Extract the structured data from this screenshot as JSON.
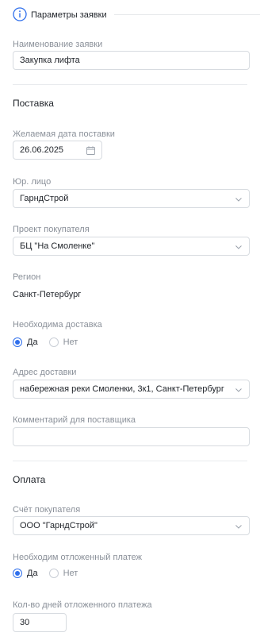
{
  "header": {
    "title": "Параметры заявки",
    "icon": "info-icon"
  },
  "request_name": {
    "label": "Наименование заявки",
    "value": "Закупка лифта"
  },
  "delivery": {
    "section_title": "Поставка",
    "date": {
      "label": "Желаемая дата поставки",
      "value": "26.06.2025"
    },
    "legal_entity": {
      "label": "Юр. лицо",
      "value": "ГарндСтрой"
    },
    "project": {
      "label": "Проект покупателя",
      "value": "БЦ \"На Смоленке\""
    },
    "region": {
      "label": "Регион",
      "value": "Санкт-Петербург"
    },
    "delivery_needed": {
      "label": "Необходима доставка",
      "options": [
        "Да",
        "Нет"
      ],
      "selected": "Да"
    },
    "address": {
      "label": "Адрес доставки",
      "value": "набережная реки Смоленки, 3к1, Санкт-Петербург"
    },
    "comment": {
      "label": "Комментарий для поставщика",
      "value": ""
    }
  },
  "payment": {
    "section_title": "Оплата",
    "account": {
      "label": "Счёт покупателя",
      "value": "ООО \"ГарндСтрой\""
    },
    "deferred": {
      "label": "Необходим отложенный платеж",
      "options": [
        "Да",
        "Нет"
      ],
      "selected": "Да"
    },
    "deferred_days": {
      "label": "Кол-во дней отложенного платежа",
      "value": "30"
    }
  },
  "colors": {
    "accent": "#2f6fec",
    "label": "#8a9099",
    "text": "#1f2329",
    "border": "#d7dbe0"
  }
}
